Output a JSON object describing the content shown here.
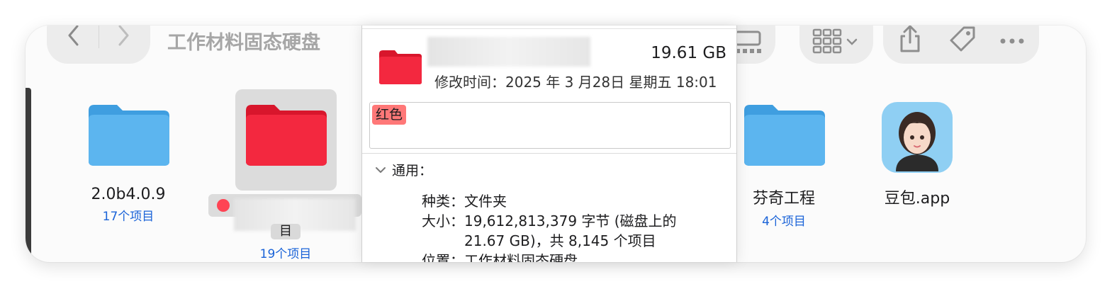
{
  "window": {
    "title": "工作材料固态硬盘"
  },
  "toolbar": {
    "back_icon": "chevron-left-icon",
    "forward_icon": "chevron-right-icon",
    "view_icon": "grid-view-icon",
    "share_icon": "share-icon",
    "tag_icon": "tag-icon",
    "more_icon": "ellipsis-icon"
  },
  "items": [
    {
      "name": "2.0b4.0.9",
      "count": "17个项目",
      "icon": "folder-icon",
      "color": "#58b2ee"
    },
    {
      "name": "",
      "count": "19个项目",
      "icon": "folder-icon",
      "color": "#f0263c",
      "second_line": "目",
      "selected": true
    },
    {
      "name": "芬奇工程",
      "count": "4个项目",
      "icon": "folder-icon",
      "color": "#58b2ee"
    },
    {
      "name": "豆包.app",
      "count": "",
      "icon": "app-icon"
    }
  ],
  "info": {
    "size": "19.61 GB",
    "modified": "修改时间：2025 年 3 月28日 星期五 18:01",
    "tag": "红色",
    "section": "通用：",
    "rows": [
      {
        "label": "种类：",
        "value": "文件夹"
      },
      {
        "label": "大小：",
        "value": "19,612,813,379 字节 (磁盘上的",
        "value2": "21.67 GB)，共 8,145 个项目"
      },
      {
        "label": "位置：",
        "value": "工作材料固态硬盘"
      }
    ]
  },
  "colors": {
    "tag_red": "#ff4454",
    "link_blue": "#1a63d8"
  }
}
